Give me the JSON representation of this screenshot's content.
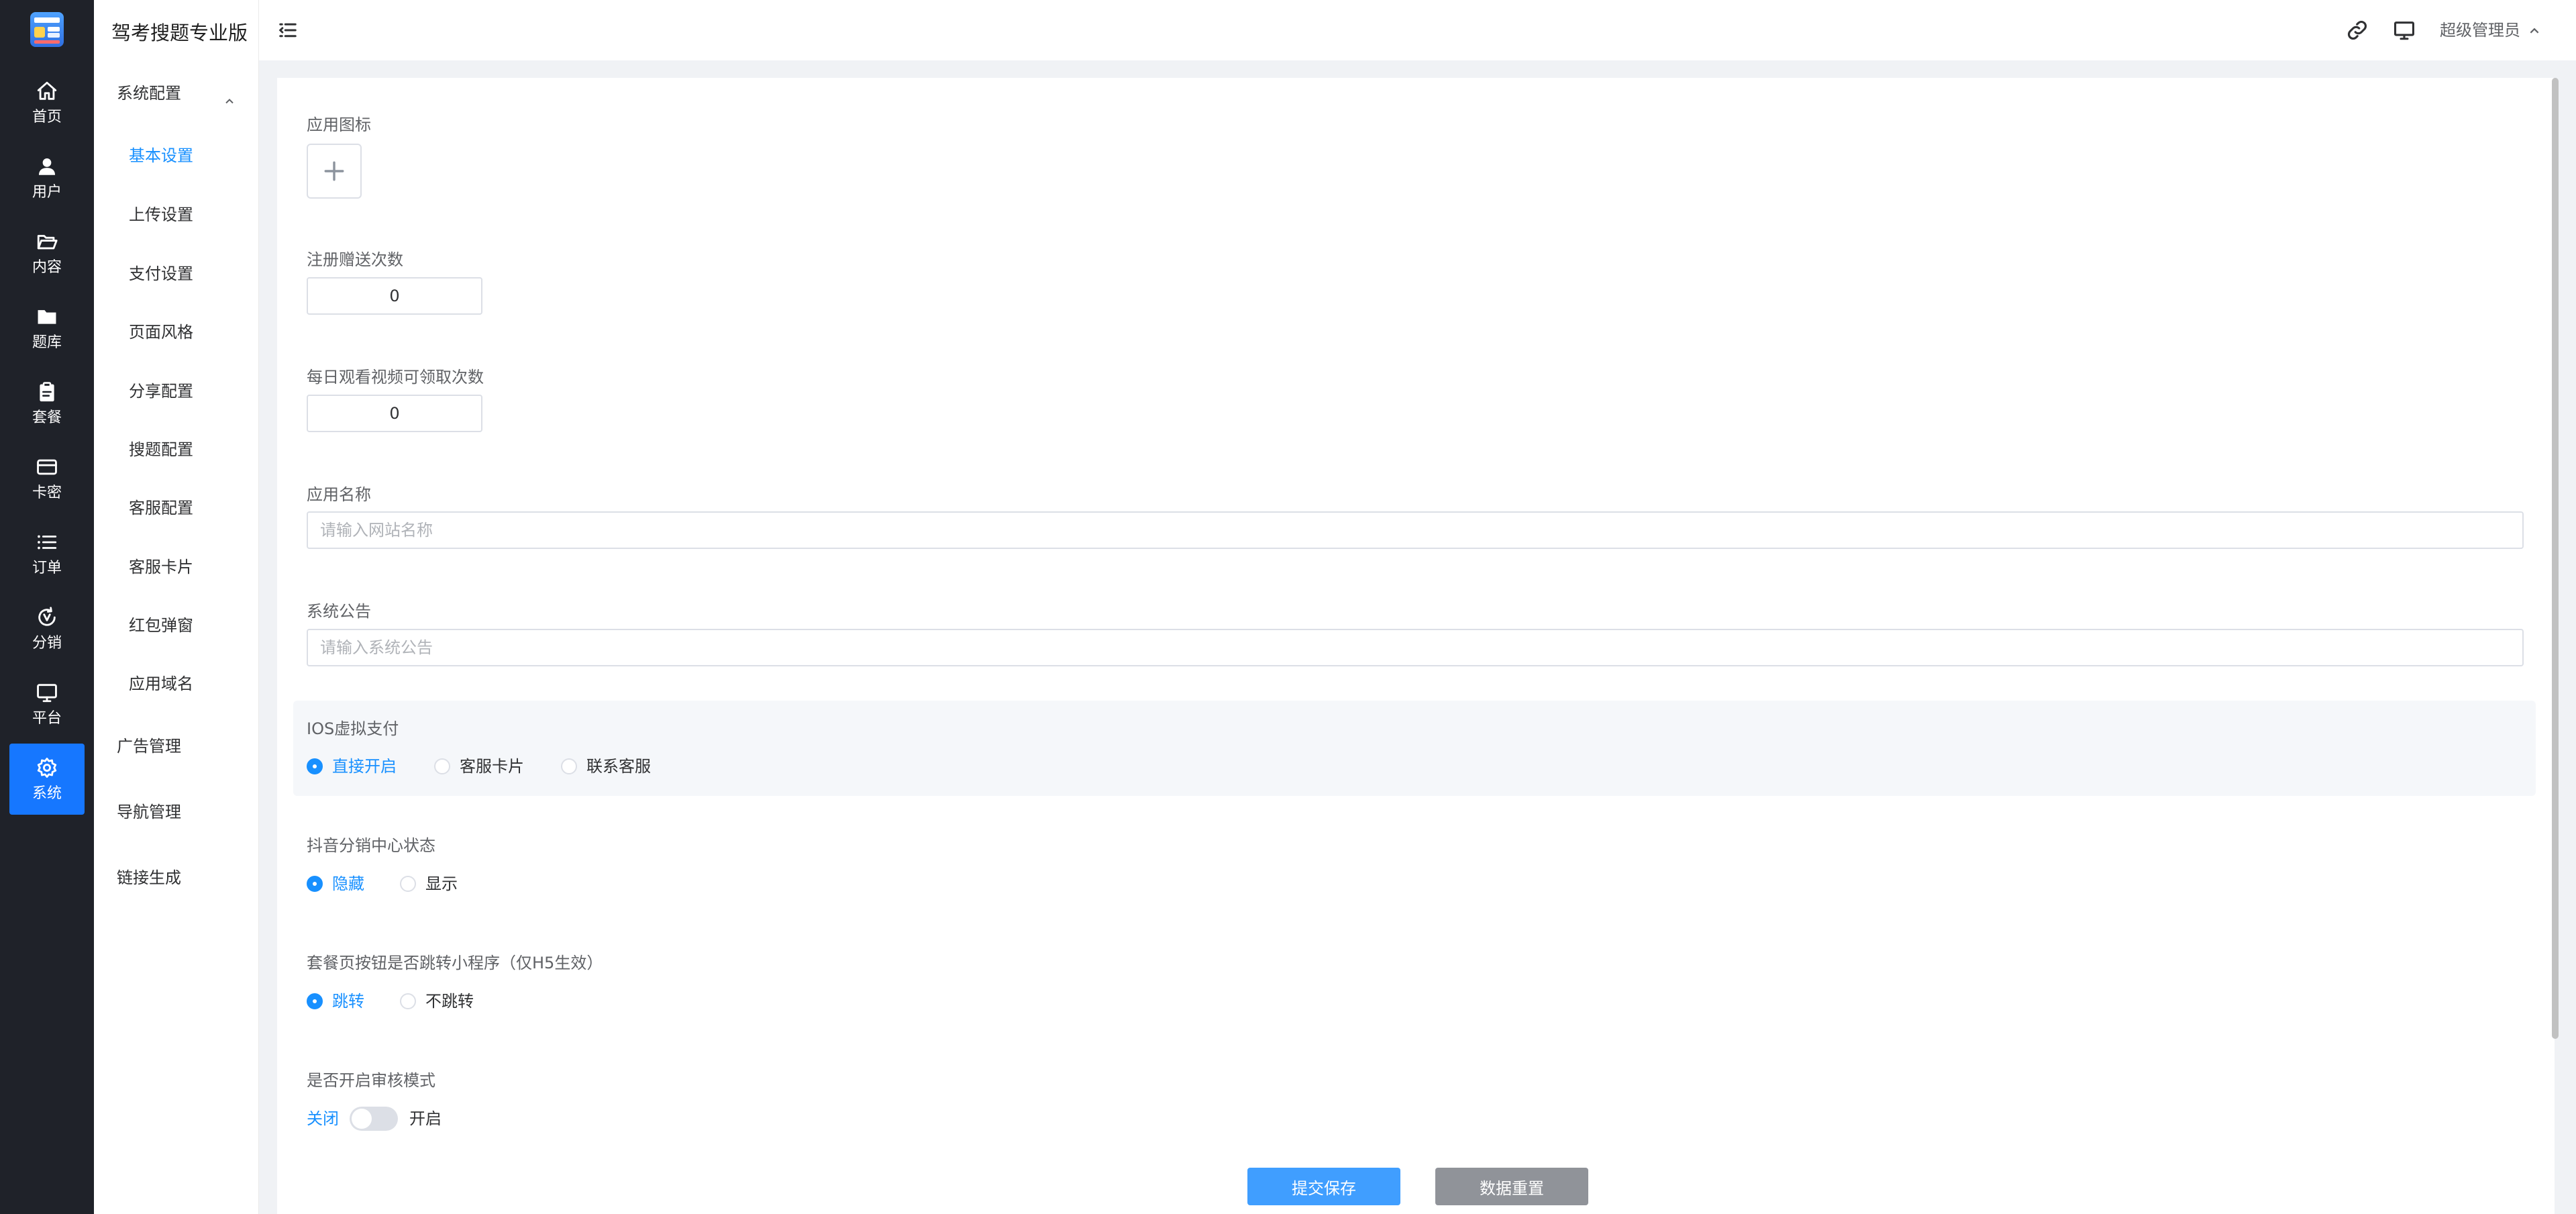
{
  "rail": {
    "items": [
      {
        "label": "首页",
        "icon": "home-icon"
      },
      {
        "label": "用户",
        "icon": "user-icon"
      },
      {
        "label": "内容",
        "icon": "folder-open-icon"
      },
      {
        "label": "题库",
        "icon": "folder-icon"
      },
      {
        "label": "套餐",
        "icon": "clipboard-icon"
      },
      {
        "label": "卡密",
        "icon": "card-icon"
      },
      {
        "label": "订单",
        "icon": "list-icon"
      },
      {
        "label": "分销",
        "icon": "distribution-icon"
      },
      {
        "label": "平台",
        "icon": "monitor-icon"
      },
      {
        "label": "系统",
        "icon": "gear-icon",
        "active": true
      }
    ],
    "active_color": "#1677ff"
  },
  "submenu": {
    "app_title": "驾考搜题专业版",
    "group_system": "系统配置",
    "items": [
      "基本设置",
      "上传设置",
      "支付设置",
      "页面风格",
      "分享配置",
      "搜题配置",
      "客服配置",
      "客服卡片",
      "红包弹窗",
      "应用域名"
    ],
    "active_item": "基本设置",
    "group_ads": "广告管理",
    "group_nav": "导航管理",
    "group_link": "链接生成"
  },
  "header": {
    "user_name": "超级管理员",
    "icons": [
      "menu-fold-icon",
      "link-icon",
      "monitor-icon",
      "chevron-up-icon"
    ]
  },
  "form": {
    "app_icon_label": "应用图标",
    "register_gift_label": "注册赠送次数",
    "register_gift_value": "0",
    "daily_video_label": "每日观看视频可领取次数",
    "daily_video_value": "0",
    "app_name_label": "应用名称",
    "app_name_placeholder": "请输入网站名称",
    "notice_label": "系统公告",
    "notice_placeholder": "请输入系统公告",
    "ios_pay_label": "IOS虚拟支付",
    "ios_pay_options": [
      "直接开启",
      "客服卡片",
      "联系客服"
    ],
    "ios_pay_selected": "直接开启",
    "douyin_label": "抖音分销中心状态",
    "douyin_options": [
      "隐藏",
      "显示"
    ],
    "douyin_selected": "隐藏",
    "package_jump_label": "套餐页按钮是否跳转小程序（仅H5生效）",
    "package_jump_options": [
      "跳转",
      "不跳转"
    ],
    "package_jump_selected": "跳转",
    "review_mode_label": "是否开启审核模式",
    "review_off_label": "关闭",
    "review_on_label": "开启",
    "review_mode_on": false
  },
  "actions": {
    "submit_label": "提交保存",
    "reset_label": "数据重置"
  },
  "colors": {
    "primary": "#409eff",
    "active_text": "#1890ff",
    "rail_bg": "#1f2229",
    "reset_button": "#909399"
  }
}
